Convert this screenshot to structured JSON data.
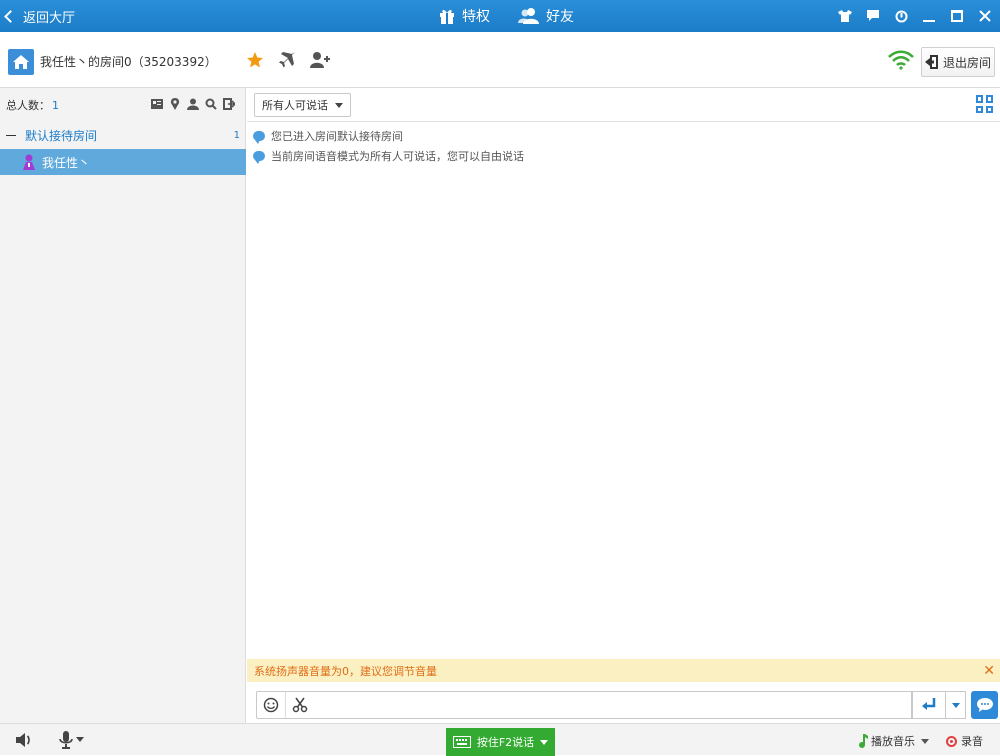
{
  "topbar": {
    "back_label": "返回大厅",
    "privilege_label": "特权",
    "friends_label": "好友"
  },
  "room": {
    "title": "我任性丶的房间0（35203392）",
    "exit_label": "退出房间"
  },
  "left": {
    "total_label": "总人数：",
    "total_count": "1",
    "group_name": "默认接待房间",
    "group_count": "1",
    "user_name": "我任性丶"
  },
  "main": {
    "mode_select": "所有人可说话",
    "messages": [
      "您已进入房间默认接待房间",
      "当前房间语音模式为所有人可说话，您可以自由说话"
    ],
    "warning": "系统扬声器音量为0，建议您调节音量"
  },
  "bottom": {
    "ptt_label": "按住F2说话",
    "music_label": "播放音乐",
    "record_label": "录音"
  },
  "colors": {
    "titlebar": "#1c7cc8",
    "selected_row": "#5fa9dd",
    "ptt_green": "#33aa32",
    "warning_text": "#e06d16",
    "wifi_green": "#3caa34",
    "star": "#f29a12"
  }
}
